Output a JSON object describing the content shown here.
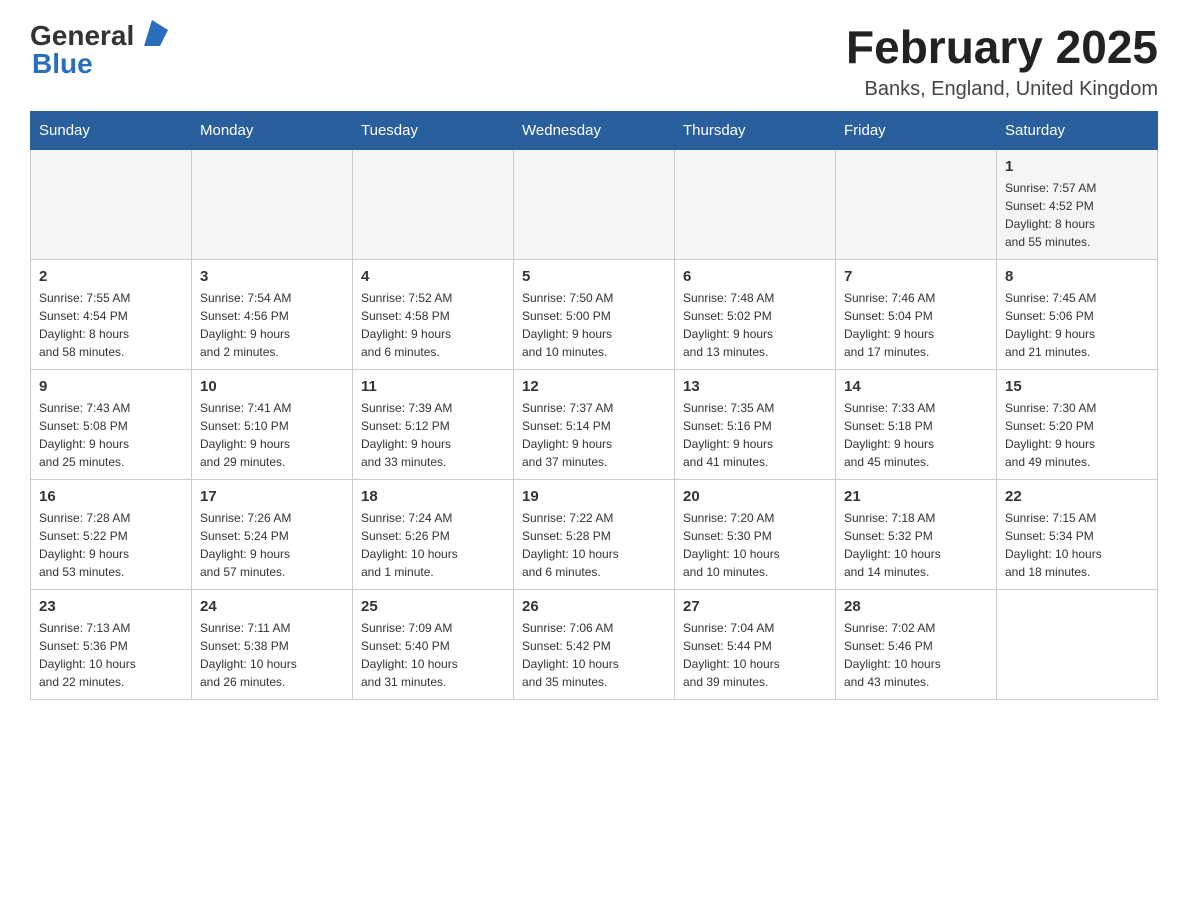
{
  "header": {
    "logo_general": "General",
    "logo_blue": "Blue",
    "title": "February 2025",
    "location": "Banks, England, United Kingdom"
  },
  "days_of_week": [
    "Sunday",
    "Monday",
    "Tuesday",
    "Wednesday",
    "Thursday",
    "Friday",
    "Saturday"
  ],
  "weeks": [
    {
      "cells": [
        {
          "day": "",
          "info": ""
        },
        {
          "day": "",
          "info": ""
        },
        {
          "day": "",
          "info": ""
        },
        {
          "day": "",
          "info": ""
        },
        {
          "day": "",
          "info": ""
        },
        {
          "day": "",
          "info": ""
        },
        {
          "day": "1",
          "info": "Sunrise: 7:57 AM\nSunset: 4:52 PM\nDaylight: 8 hours\nand 55 minutes."
        }
      ]
    },
    {
      "cells": [
        {
          "day": "2",
          "info": "Sunrise: 7:55 AM\nSunset: 4:54 PM\nDaylight: 8 hours\nand 58 minutes."
        },
        {
          "day": "3",
          "info": "Sunrise: 7:54 AM\nSunset: 4:56 PM\nDaylight: 9 hours\nand 2 minutes."
        },
        {
          "day": "4",
          "info": "Sunrise: 7:52 AM\nSunset: 4:58 PM\nDaylight: 9 hours\nand 6 minutes."
        },
        {
          "day": "5",
          "info": "Sunrise: 7:50 AM\nSunset: 5:00 PM\nDaylight: 9 hours\nand 10 minutes."
        },
        {
          "day": "6",
          "info": "Sunrise: 7:48 AM\nSunset: 5:02 PM\nDaylight: 9 hours\nand 13 minutes."
        },
        {
          "day": "7",
          "info": "Sunrise: 7:46 AM\nSunset: 5:04 PM\nDaylight: 9 hours\nand 17 minutes."
        },
        {
          "day": "8",
          "info": "Sunrise: 7:45 AM\nSunset: 5:06 PM\nDaylight: 9 hours\nand 21 minutes."
        }
      ]
    },
    {
      "cells": [
        {
          "day": "9",
          "info": "Sunrise: 7:43 AM\nSunset: 5:08 PM\nDaylight: 9 hours\nand 25 minutes."
        },
        {
          "day": "10",
          "info": "Sunrise: 7:41 AM\nSunset: 5:10 PM\nDaylight: 9 hours\nand 29 minutes."
        },
        {
          "day": "11",
          "info": "Sunrise: 7:39 AM\nSunset: 5:12 PM\nDaylight: 9 hours\nand 33 minutes."
        },
        {
          "day": "12",
          "info": "Sunrise: 7:37 AM\nSunset: 5:14 PM\nDaylight: 9 hours\nand 37 minutes."
        },
        {
          "day": "13",
          "info": "Sunrise: 7:35 AM\nSunset: 5:16 PM\nDaylight: 9 hours\nand 41 minutes."
        },
        {
          "day": "14",
          "info": "Sunrise: 7:33 AM\nSunset: 5:18 PM\nDaylight: 9 hours\nand 45 minutes."
        },
        {
          "day": "15",
          "info": "Sunrise: 7:30 AM\nSunset: 5:20 PM\nDaylight: 9 hours\nand 49 minutes."
        }
      ]
    },
    {
      "cells": [
        {
          "day": "16",
          "info": "Sunrise: 7:28 AM\nSunset: 5:22 PM\nDaylight: 9 hours\nand 53 minutes."
        },
        {
          "day": "17",
          "info": "Sunrise: 7:26 AM\nSunset: 5:24 PM\nDaylight: 9 hours\nand 57 minutes."
        },
        {
          "day": "18",
          "info": "Sunrise: 7:24 AM\nSunset: 5:26 PM\nDaylight: 10 hours\nand 1 minute."
        },
        {
          "day": "19",
          "info": "Sunrise: 7:22 AM\nSunset: 5:28 PM\nDaylight: 10 hours\nand 6 minutes."
        },
        {
          "day": "20",
          "info": "Sunrise: 7:20 AM\nSunset: 5:30 PM\nDaylight: 10 hours\nand 10 minutes."
        },
        {
          "day": "21",
          "info": "Sunrise: 7:18 AM\nSunset: 5:32 PM\nDaylight: 10 hours\nand 14 minutes."
        },
        {
          "day": "22",
          "info": "Sunrise: 7:15 AM\nSunset: 5:34 PM\nDaylight: 10 hours\nand 18 minutes."
        }
      ]
    },
    {
      "cells": [
        {
          "day": "23",
          "info": "Sunrise: 7:13 AM\nSunset: 5:36 PM\nDaylight: 10 hours\nand 22 minutes."
        },
        {
          "day": "24",
          "info": "Sunrise: 7:11 AM\nSunset: 5:38 PM\nDaylight: 10 hours\nand 26 minutes."
        },
        {
          "day": "25",
          "info": "Sunrise: 7:09 AM\nSunset: 5:40 PM\nDaylight: 10 hours\nand 31 minutes."
        },
        {
          "day": "26",
          "info": "Sunrise: 7:06 AM\nSunset: 5:42 PM\nDaylight: 10 hours\nand 35 minutes."
        },
        {
          "day": "27",
          "info": "Sunrise: 7:04 AM\nSunset: 5:44 PM\nDaylight: 10 hours\nand 39 minutes."
        },
        {
          "day": "28",
          "info": "Sunrise: 7:02 AM\nSunset: 5:46 PM\nDaylight: 10 hours\nand 43 minutes."
        },
        {
          "day": "",
          "info": ""
        }
      ]
    }
  ]
}
